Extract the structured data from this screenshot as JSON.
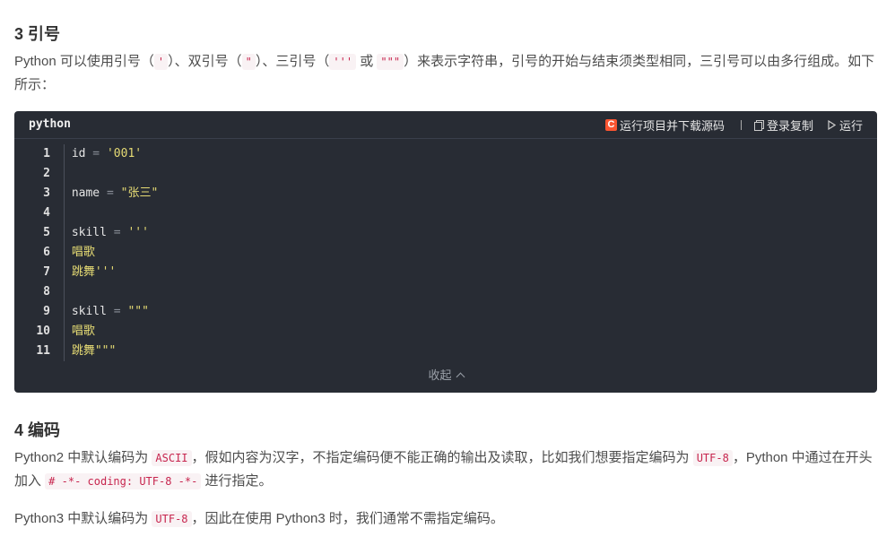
{
  "section3": {
    "title": "3 引号",
    "p1_a": "Python 可以使用引号（",
    "p1_c1": "'",
    "p1_b": "）、双引号（",
    "p1_c2": "\"",
    "p1_c": "）、三引号（",
    "p1_c3": "'''",
    "p1_d": " 或 ",
    "p1_c4": "\"\"\"",
    "p1_e": "）来表示字符串，引号的开始与结束须类型相同，三引号可以由多行组成。如下所示："
  },
  "codeblock": {
    "language": "python",
    "run_download_label": "运行项目并下载源码",
    "copy_label": "登录复制",
    "run_label": "运行",
    "collapse_label": "收起",
    "line_numbers": [
      "1",
      "2",
      "3",
      "4",
      "5",
      "6",
      "7",
      "8",
      "9",
      "10",
      "11"
    ],
    "lines": [
      {
        "id": "id",
        "op": " = ",
        "str": "'001'"
      },
      {
        "id": "",
        "op": "",
        "str": ""
      },
      {
        "id": "name",
        "op": " = ",
        "str": "\"张三\""
      },
      {
        "id": "",
        "op": "",
        "str": ""
      },
      {
        "id": "skill",
        "op": " = ",
        "str": "'''"
      },
      {
        "id": "",
        "op": "",
        "str": "唱歌"
      },
      {
        "id": "",
        "op": "",
        "str": "跳舞'''"
      },
      {
        "id": "",
        "op": "",
        "str": ""
      },
      {
        "id": "skill",
        "op": " = ",
        "str": "\"\"\""
      },
      {
        "id": "",
        "op": "",
        "str": "唱歌"
      },
      {
        "id": "",
        "op": "",
        "str": "跳舞\"\"\""
      }
    ]
  },
  "section4": {
    "title": "4 编码",
    "p2_a": "Python2 中默认编码为 ",
    "p2_c1": "ASCII",
    "p2_b": "，假如内容为汉字，不指定编码便不能正确的输出及读取，比如我们想要指定编码为 ",
    "p2_c2": "UTF-8",
    "p2_c": "，Python 中通过在开头加入 ",
    "p2_c3": "# -*- coding: UTF-8 -*-",
    "p2_d": " 进行指定。",
    "p3_a": "Python3 中默认编码为 ",
    "p3_c1": "UTF-8",
    "p3_b": "，因此在使用 Python3 时，我们通常不需指定编码。"
  }
}
